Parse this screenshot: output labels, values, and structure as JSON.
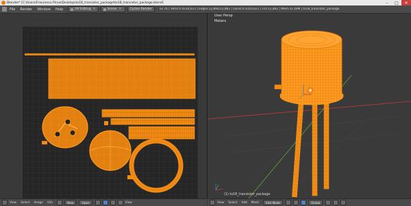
{
  "window": {
    "title": "Blender* [C:\\Users\\Francesco Pinus\\Desktop\\to18_transistor_package\\to18_transistor_package.blend]",
    "minimize": "–",
    "maximize": "□",
    "close": "✕"
  },
  "menu": {
    "items": [
      "File",
      "Render",
      "Window",
      "Help"
    ],
    "layout": "UV Editing",
    "scene": "Scene",
    "engine": "Cycles Render",
    "stats": "v2.76 | Verts:0.4316,613 | Edges:12,892/12,862 | Faces:0.4316,621 | Tris:12,862 | Mem:31.49M | to18_transistor_package"
  },
  "viewport": {
    "view_label": "User Persp",
    "units_label": "Meters",
    "object_label": "(1) to18_transistor_package"
  },
  "uv_footer": {
    "items": [
      "View",
      "Select",
      "Image",
      "UVs"
    ],
    "image_label": "New",
    "open_label": "Open",
    "view_label2": "View"
  },
  "vp_footer": {
    "items": [
      "View",
      "Select",
      "Add",
      "Mesh"
    ],
    "mode": "Edit Mode",
    "pivot": "Global"
  },
  "colors": {
    "uv_grid_bg": "#262626",
    "mesh_orange": "#ff9a1f",
    "mesh_edge": "#e07d0c",
    "viewport_bg": "#3a3a3a",
    "axis_red": "#c03a3a",
    "axis_green": "#5fa83a"
  }
}
